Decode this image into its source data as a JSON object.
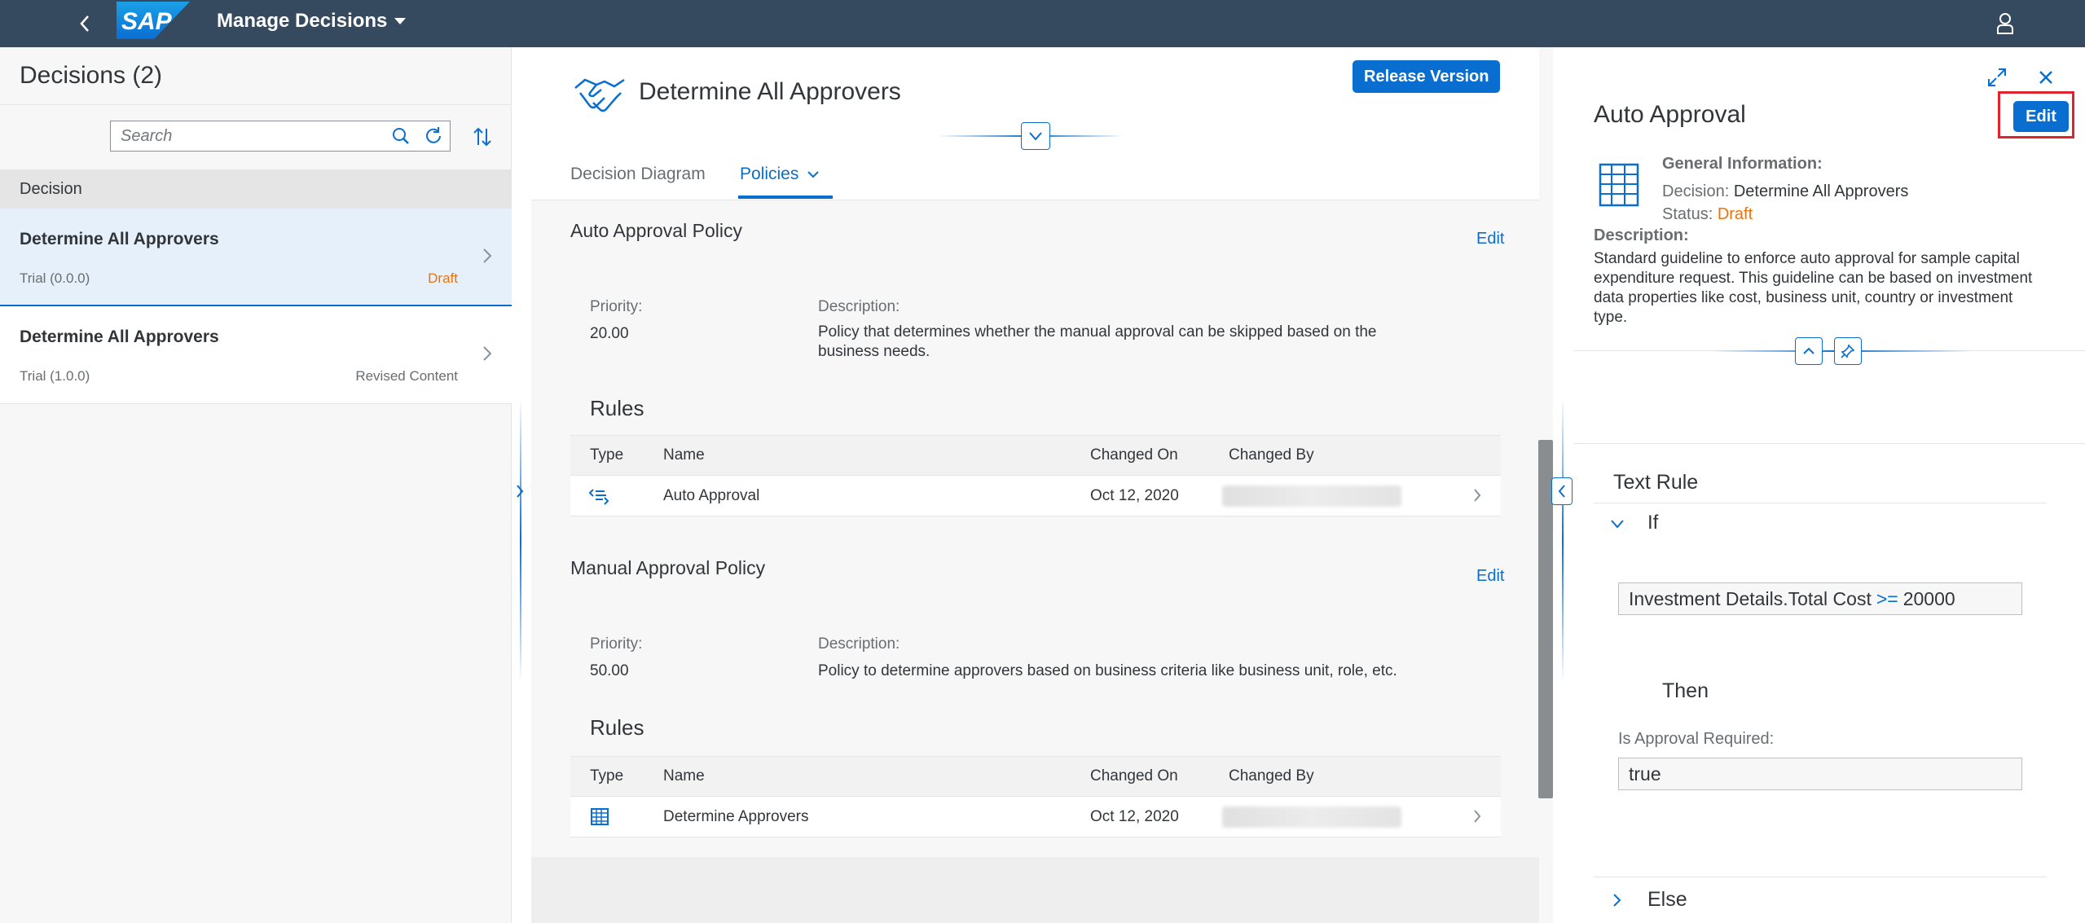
{
  "shell": {
    "app_title": "Manage Decisions",
    "logo_text": "SAP"
  },
  "left": {
    "title": "Decisions (2)",
    "search_placeholder": "Search",
    "column_header": "Decision",
    "items": [
      {
        "title": "Determine All Approvers",
        "subtitle": "Trial (0.0.0)",
        "status": "Draft",
        "status_color": "#e9730c"
      },
      {
        "title": "Determine All Approvers",
        "subtitle": "Trial (1.0.0)",
        "status": "Revised Content",
        "status_color": "#6a6d70"
      }
    ]
  },
  "middle": {
    "title": "Determine All Approvers",
    "release_label": "Release Version",
    "tabs": [
      "Decision Diagram",
      "Policies"
    ],
    "policies": [
      {
        "name": "Auto Approval Policy",
        "edit_label": "Edit",
        "priority_label": "Priority:",
        "priority": "20.00",
        "description_label": "Description:",
        "description_line1": "Policy that determines whether the manual approval can be skipped based on the",
        "description_line2": "business needs.",
        "rules_title": "Rules",
        "columns": [
          "Type",
          "Name",
          "Changed On",
          "Changed By"
        ],
        "rows": [
          {
            "type_icon": "text-rule-icon",
            "name": "Auto Approval",
            "changed_on": "Oct 12, 2020"
          }
        ]
      },
      {
        "name": "Manual Approval Policy",
        "edit_label": "Edit",
        "priority_label": "Priority:",
        "priority": "50.00",
        "description_label": "Description:",
        "description_line1": "Policy to determine approvers based on business criteria like business unit, role, etc.",
        "description_line2": "",
        "rules_title": "Rules",
        "columns": [
          "Type",
          "Name",
          "Changed On",
          "Changed By"
        ],
        "rows": [
          {
            "type_icon": "decision-table-icon",
            "name": "Determine Approvers",
            "changed_on": "Oct 12, 2020"
          }
        ]
      }
    ]
  },
  "right": {
    "title": "Auto Approval",
    "edit_label": "Edit",
    "general_info_label": "General Information:",
    "decision_label": "Decision:",
    "decision_value": "Determine All Approvers",
    "status_label": "Status:",
    "status_value": "Draft",
    "description_label": "Description:",
    "description": "Standard guideline to enforce auto approval for sample capital expenditure request. This guideline can be based on investment data properties like cost, business unit, country or investment type.",
    "rule_type": "Text Rule",
    "if_label": "If",
    "condition_left": "Investment Details.Total Cost",
    "condition_operator": ">=",
    "condition_right": "20000",
    "then_label": "Then",
    "result_label": "Is Approval Required:",
    "result_value": "true",
    "else_label": "Else"
  },
  "colors": {
    "shell": "#354a5f",
    "accent": "#0a6ed1",
    "draft": "#e9730c",
    "highlight_box": "#e0242e"
  }
}
